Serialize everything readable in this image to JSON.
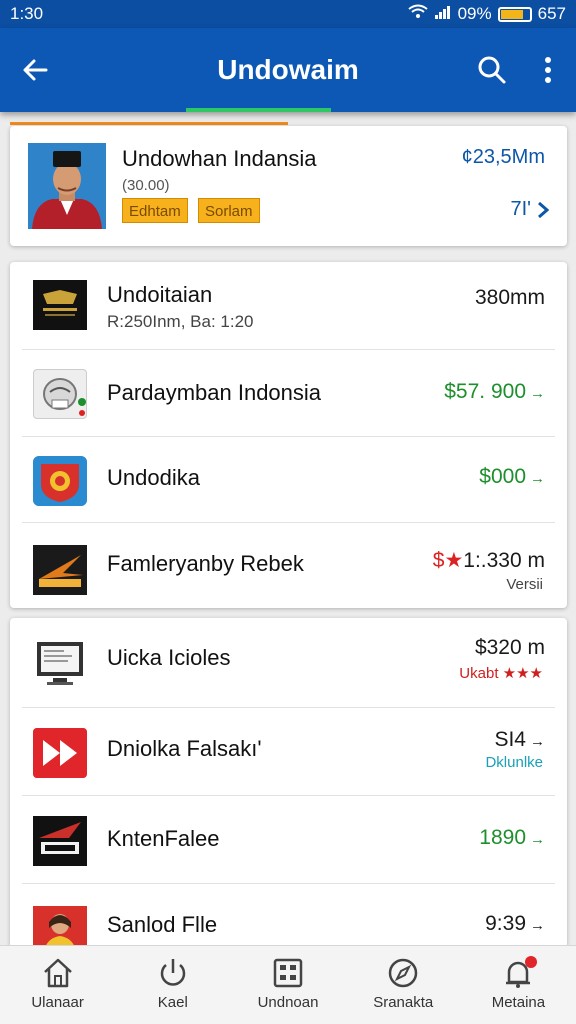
{
  "status_bar": {
    "time": "1:30",
    "signal_text": "09%",
    "battery_text": "657",
    "battery_level": 0.8
  },
  "app_bar": {
    "title": "Undowaim",
    "icons": [
      "arrow-left-icon",
      "search-icon",
      "more-vert-icon"
    ]
  },
  "featured": {
    "title": "Undowhan Indansia",
    "subtitle": "(30.00)",
    "badges": [
      "Edhtam",
      "Sorlam"
    ],
    "amount": "¢23,5Mm",
    "count": "7I'"
  },
  "list_a": [
    {
      "name": "Undoitaian",
      "meta": "R:250Inm, Ba: 1:20",
      "value": "380mm",
      "value_color": "#1a1a1a"
    },
    {
      "name": "Pardaymban Indonsia",
      "value": "$57. 900",
      "value_color": "#1d8f2c",
      "arrow": "→"
    },
    {
      "name": "Undodika",
      "value": "$000",
      "value_color": "#1d8f2c",
      "arrow": "→"
    },
    {
      "name": "Famleryanby Rebek",
      "value_prefix": "$",
      "value": "1:.330 m",
      "value_color": "#1a1a1a",
      "note": "Versii",
      "note_color": "#444"
    }
  ],
  "list_b": [
    {
      "name": "Uicka Icioles",
      "value": "$320 m",
      "value_color": "#1a1a1a",
      "note": "Ukabt ★★★",
      "note_color": "#cf2020"
    },
    {
      "name": "Dniolka Falsakı'",
      "value": "SI4",
      "value_color": "#1a1a1a",
      "arrow": "→",
      "note": "Dklunlke",
      "note_color": "#1aa0b8"
    },
    {
      "name": "KntenFalee",
      "value": "1890",
      "value_color": "#1d8f2c",
      "arrow": "→"
    },
    {
      "name": "Sanlod Flle",
      "value": "9:39",
      "value_color": "#1a1a1a",
      "arrow": "→"
    }
  ],
  "bottom_nav": [
    {
      "label": "Ulanaar",
      "icon": "home-icon"
    },
    {
      "label": "Kael",
      "icon": "power-icon"
    },
    {
      "label": "Undnoan",
      "icon": "grid-icon"
    },
    {
      "label": "Sranakta",
      "icon": "compass-icon"
    },
    {
      "label": "Metaina",
      "icon": "bell-icon",
      "badge": true
    }
  ],
  "colors": {
    "app_bar": "#0d58b5",
    "status_bar": "#0b4ea2",
    "accent_green": "#2ec765",
    "orange": "#f08a1c",
    "price_green": "#1d8f2c"
  }
}
